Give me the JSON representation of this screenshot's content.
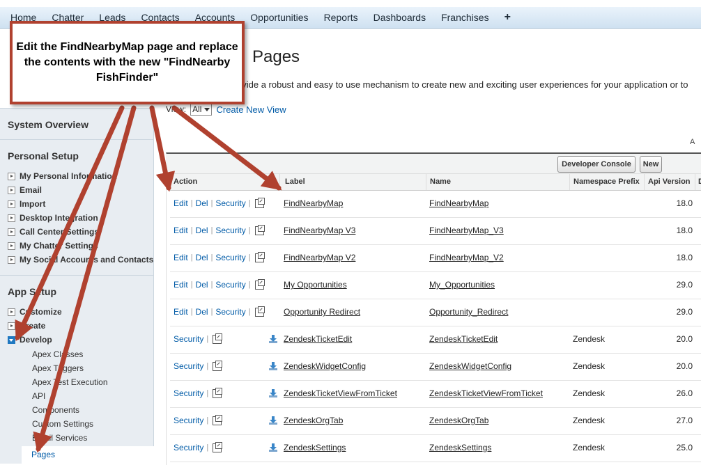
{
  "tabs": [
    "Home",
    "Chatter",
    "Leads",
    "Contacts",
    "Accounts",
    "Opportunities",
    "Reports",
    "Dashboards",
    "Franchises",
    "+"
  ],
  "header": {
    "title": "Pages",
    "description": "ovide a robust and easy to use mechanism to create new and exciting user experiences for your application or to",
    "view_label": "View:",
    "view_value": "All",
    "create_view": "Create New View",
    "alpha_letter": "A"
  },
  "sidebar": {
    "system_overview": "System Overview",
    "personal_setup": {
      "title": "Personal Setup",
      "items": [
        "My Personal Information",
        "Email",
        "Import",
        "Desktop Integration",
        "Call Center Settings",
        "My Chatter Settings",
        "My Social Accounts and Contacts"
      ]
    },
    "app_setup": {
      "title": "App Setup",
      "items": [
        "Customize",
        "Create",
        "Develop"
      ],
      "develop_children": [
        "Apex Classes",
        "Apex Triggers",
        "Apex Test Execution",
        "API",
        "Components",
        "Custom Settings",
        "Email Services"
      ],
      "selected": "Pages"
    }
  },
  "toolbar": {
    "developer_console": "Developer Console",
    "new": "New"
  },
  "columns": [
    "Action",
    "Label",
    "Name",
    "Namespace Prefix",
    "Api Version",
    "D"
  ],
  "action_labels": {
    "edit": "Edit",
    "del": "Del",
    "security": "Security"
  },
  "rows": [
    {
      "label": "FindNearbyMap",
      "name": "FindNearbyMap",
      "ns": "",
      "api": "18.0",
      "managed": false
    },
    {
      "label": "FindNearbyMap V3",
      "name": "FindNearbyMap_V3",
      "ns": "",
      "api": "18.0",
      "managed": false
    },
    {
      "label": "FindNearbyMap V2",
      "name": "FindNearbyMap_V2",
      "ns": "",
      "api": "18.0",
      "managed": false
    },
    {
      "label": "My Opportunities",
      "name": "My_Opportunities",
      "ns": "",
      "api": "29.0",
      "managed": false
    },
    {
      "label": "Opportunity Redirect",
      "name": "Opportunity_Redirect",
      "ns": "",
      "api": "29.0",
      "managed": false
    },
    {
      "label": "ZendeskTicketEdit",
      "name": "ZendeskTicketEdit",
      "ns": "Zendesk",
      "api": "20.0",
      "managed": true
    },
    {
      "label": "ZendeskWidgetConfig",
      "name": "ZendeskWidgetConfig",
      "ns": "Zendesk",
      "api": "20.0",
      "managed": true
    },
    {
      "label": "ZendeskTicketViewFromTicket",
      "name": "ZendeskTicketViewFromTicket",
      "ns": "Zendesk",
      "api": "26.0",
      "managed": true
    },
    {
      "label": "ZendeskOrgTab",
      "name": "ZendeskOrgTab",
      "ns": "Zendesk",
      "api": "27.0",
      "managed": true
    },
    {
      "label": "ZendeskSettings",
      "name": "ZendeskSettings",
      "ns": "Zendesk",
      "api": "25.0",
      "managed": true
    }
  ],
  "callout": "Edit the FindNearbyMap page and replace the contents with the new \"FindNearby FishFinder\"",
  "colors": {
    "arrow": "#b0412f",
    "link": "#015ba7"
  }
}
